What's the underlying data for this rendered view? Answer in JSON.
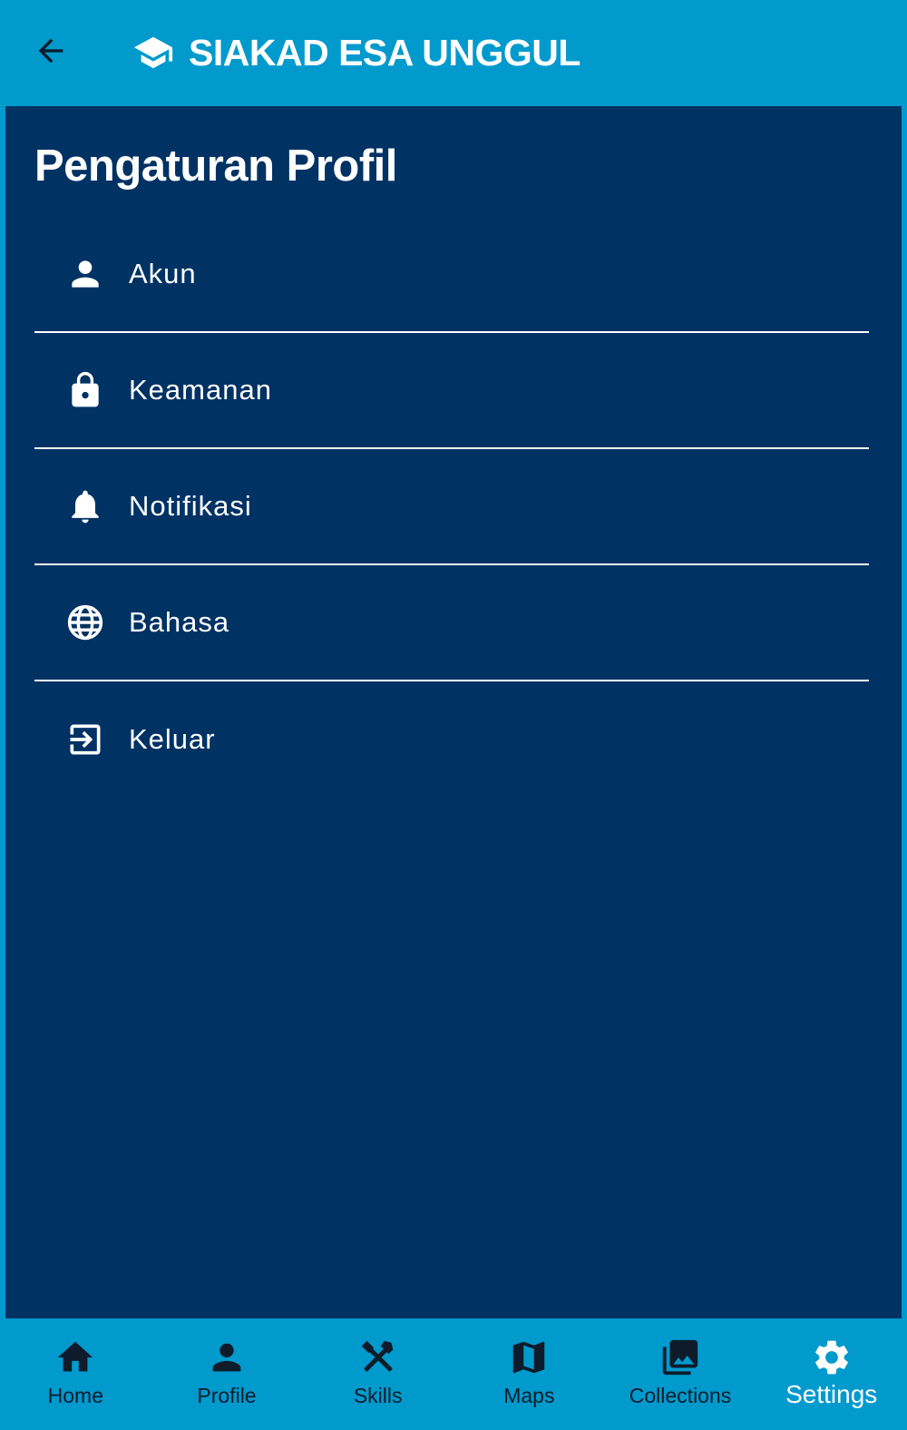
{
  "app": {
    "title": "SIAKAD ESA UNGGUL",
    "back_icon": "arrow-back-icon",
    "brand_icon": "graduation-cap-icon"
  },
  "page": {
    "title": "Pengaturan Profil"
  },
  "menu": {
    "items": [
      {
        "label": "Akun",
        "icon": "person-icon"
      },
      {
        "label": "Keamanan",
        "icon": "lock-icon"
      },
      {
        "label": "Notifikasi",
        "icon": "bell-icon"
      },
      {
        "label": "Bahasa",
        "icon": "globe-icon"
      },
      {
        "label": "Keluar",
        "icon": "logout-icon"
      }
    ]
  },
  "bottom_nav": {
    "active": "Settings",
    "items": [
      {
        "label": "Home",
        "icon": "home-icon"
      },
      {
        "label": "Profile",
        "icon": "person-icon"
      },
      {
        "label": "Skills",
        "icon": "tools-icon"
      },
      {
        "label": "Maps",
        "icon": "map-icon"
      },
      {
        "label": "Collections",
        "icon": "photo-library-icon"
      },
      {
        "label": "Settings",
        "icon": "gear-icon"
      }
    ]
  },
  "colors": {
    "primary": "#009acd",
    "surface": "#003264",
    "text_light": "#ffffff",
    "text_dark": "#0d1b2a"
  }
}
